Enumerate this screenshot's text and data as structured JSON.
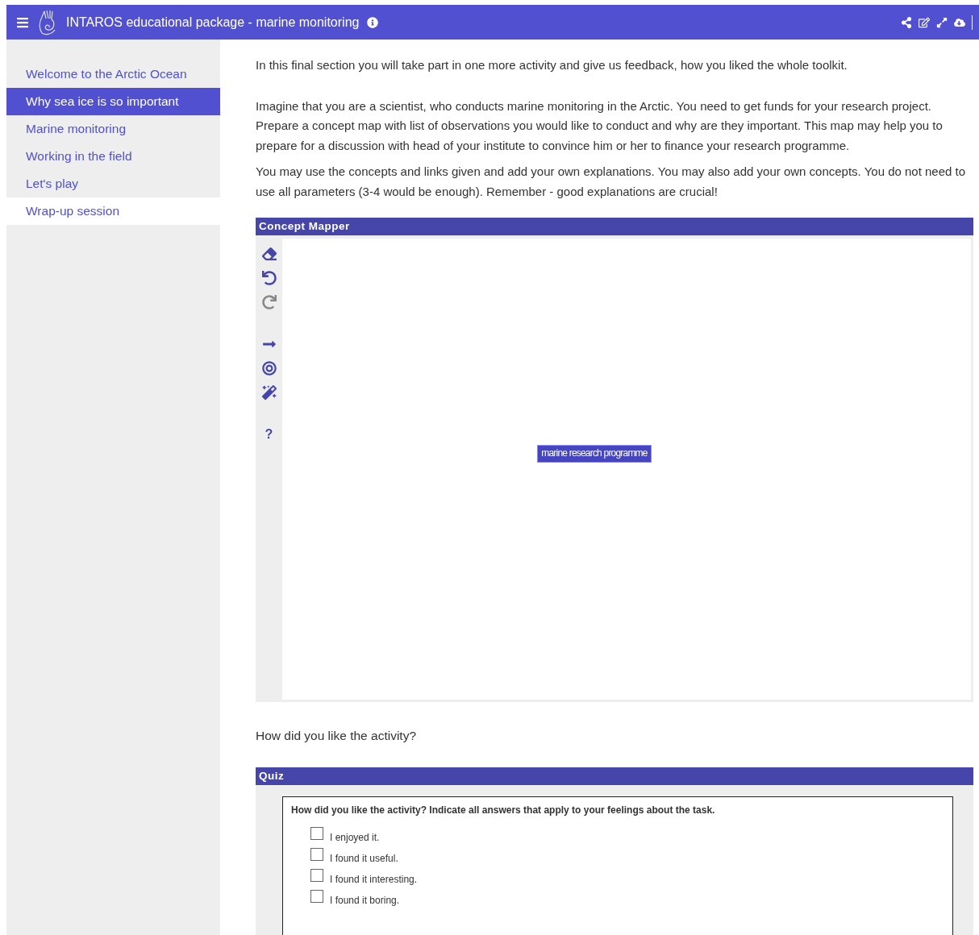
{
  "header": {
    "title": "INTAROS educational package - marine monitoring"
  },
  "sidebar": {
    "items": [
      {
        "label": "Welcome to the Arctic Ocean",
        "selected": false,
        "hovered": false
      },
      {
        "label": "Why sea ice is so important",
        "selected": true,
        "hovered": false
      },
      {
        "label": "Marine monitoring",
        "selected": false,
        "hovered": false
      },
      {
        "label": "Working in the field",
        "selected": false,
        "hovered": false
      },
      {
        "label": "Let's play",
        "selected": false,
        "hovered": false
      },
      {
        "label": "Wrap-up session",
        "selected": false,
        "hovered": true
      }
    ]
  },
  "intro": [
    "In this final section you will take part in one more activity and give us feedback, how you liked the whole toolkit.",
    "Imagine that you are a scientist, who conducts marine monitoring in the Arctic. You need to get funds for your research project. Prepare a concept map with list of observations you would like to conduct and why are they important. This map may help you to prepare for a discussion with head of your institute to convince him or her to finance your research programme.",
    "You may use the concepts and links given and add your own explanations. You may also add your own concepts. You do not need to use all parameters (3-4 would be enough). Remember - good explanations are crucial!"
  ],
  "concept_mapper": {
    "title": "Concept Mapper",
    "tools": [
      {
        "kind": "eraser",
        "disabled": false
      },
      {
        "kind": "undo",
        "disabled": false
      },
      {
        "kind": "redo",
        "disabled": true
      },
      {
        "kind": "gap"
      },
      {
        "kind": "arrow",
        "disabled": false
      },
      {
        "kind": "target",
        "disabled": false
      },
      {
        "kind": "wand",
        "disabled": false
      },
      {
        "kind": "gap"
      },
      {
        "kind": "help"
      }
    ],
    "help_glyph": "?",
    "concept": "marine research programme"
  },
  "question": "How did you like the activity?",
  "quiz": {
    "title": "Quiz",
    "prompt": "How did you like the activity? Indicate all answers that apply to your feelings about the task.",
    "options": [
      {
        "label": "I enjoyed it.",
        "checked": false
      },
      {
        "label": "I found it useful.",
        "checked": false
      },
      {
        "label": "I found it interesting.",
        "checked": false
      },
      {
        "label": "I found it boring.",
        "checked": false
      }
    ]
  }
}
